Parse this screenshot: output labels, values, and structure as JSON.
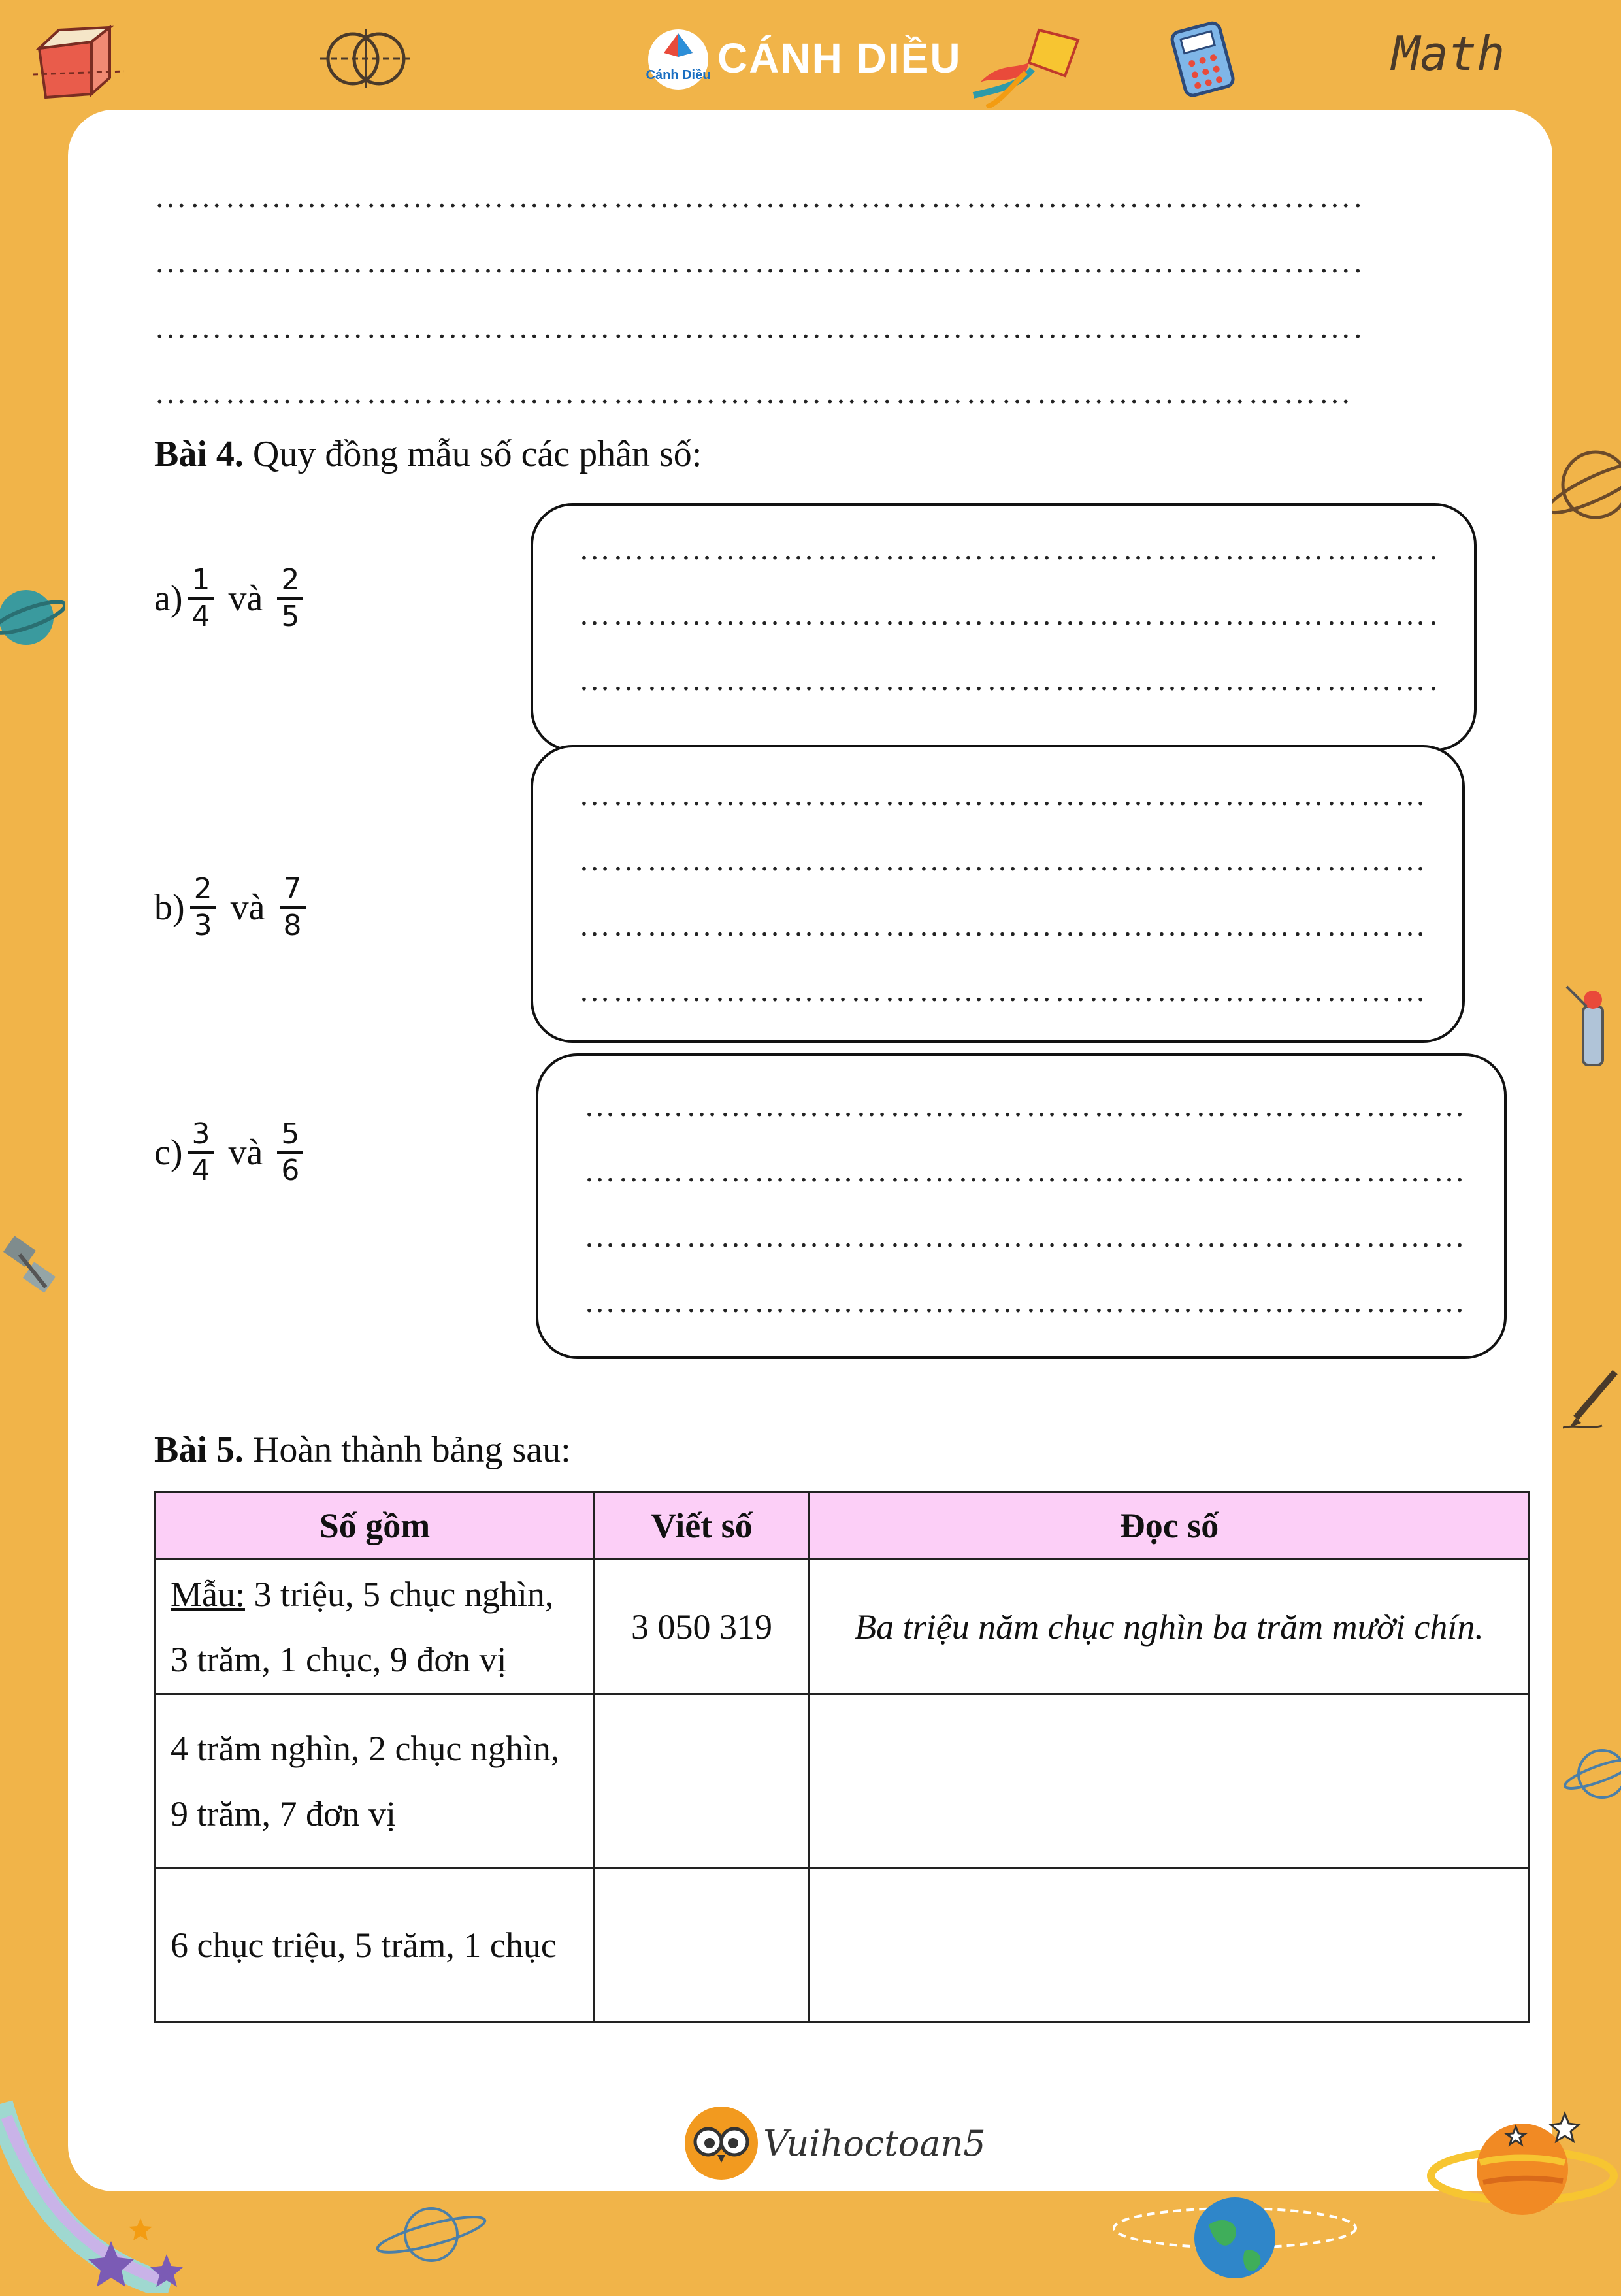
{
  "header": {
    "brand": "CÁNH DIỀU",
    "brand_logo_caption": "Cánh Diều",
    "corner_text": "Math",
    "icons": [
      "cuboid-icon",
      "venn-circles-icon",
      "kite-icon",
      "calculator-icon"
    ]
  },
  "top_dot_lines": [
    "………………………………………………………………………………………….",
    "………………………………………………………………………………………….",
    "………………………………………………………………………………………….",
    "………………………………………………………………………………………….",
    "…………………………………………………………………………………………"
  ],
  "bai4": {
    "label": "Bài 4.",
    "title": "Quy đồng mẫu số các phân số:",
    "problems": [
      {
        "letter": "a)",
        "f1_num": "1",
        "f1_den": "4",
        "connector": "và",
        "f2_num": "2",
        "f2_den": "5"
      },
      {
        "letter": "b)",
        "f1_num": "2",
        "f1_den": "3",
        "connector": "và",
        "f2_num": "7",
        "f2_den": "8"
      },
      {
        "letter": "c)",
        "f1_num": "3",
        "f1_den": "4",
        "connector": "và",
        "f2_num": "5",
        "f2_den": "6"
      }
    ],
    "box_line": "…………………………………………………………………………"
  },
  "bai5": {
    "label": "Bài 5.",
    "title": "Hoàn thành bảng sau:",
    "headers": [
      "Số gồm",
      "Viết số",
      "Đọc số"
    ],
    "sample_label": "Mẫu:",
    "rows": [
      {
        "line1": "3 triệu, 5 chục nghìn,",
        "line2": "3 trăm, 1 chục, 9 đơn vị",
        "viet_so": "3 050 319",
        "doc_so": "Ba triệu năm chục nghìn ba trăm mười chín."
      },
      {
        "line1": "4 trăm nghìn, 2 chục nghìn,",
        "line2": "9 trăm, 7 đơn vị",
        "viet_so": "",
        "doc_so": ""
      },
      {
        "line1": "6 chục triệu, 5 trăm, 1 chục",
        "line2": "",
        "viet_so": "",
        "doc_so": ""
      }
    ]
  },
  "footer": {
    "brand": "Vuihoctoan5",
    "decor_icons": [
      "planet-icon",
      "satellite-icon",
      "pencil-icon",
      "globe-icon",
      "star-icon",
      "saturn-icon"
    ]
  }
}
